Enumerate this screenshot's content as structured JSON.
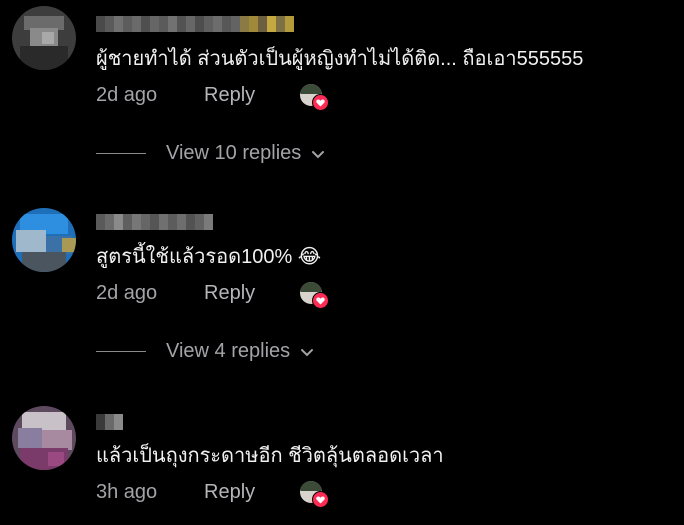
{
  "colors": {
    "background": "#000000",
    "text": "#f1f1f2",
    "muted": "#a3a3a8",
    "heart": "#fe2c55"
  },
  "comments": [
    {
      "text": "ผู้ชายทำได้ ส่วนตัวเป็นผู้หญิงทำไม่ได้ติด... ถือเอา555555",
      "age": "2d ago",
      "reply_label": "Reply",
      "creator_liked": true,
      "view_replies": "View 10 replies"
    },
    {
      "text": "สูตรนี้ใช้แล้วรอด100% 😂",
      "age": "2d ago",
      "reply_label": "Reply",
      "creator_liked": true,
      "view_replies": "View 4 replies"
    },
    {
      "text": "แล้วเป็นถุงกระดาษอีก ชีวิตลุ้นตลอดเวลา",
      "age": "3h ago",
      "reply_label": "Reply",
      "creator_liked": true
    }
  ],
  "icons": {
    "chevron": "chevron-down-icon",
    "creator_like": "creator-liked-heart-icon"
  }
}
